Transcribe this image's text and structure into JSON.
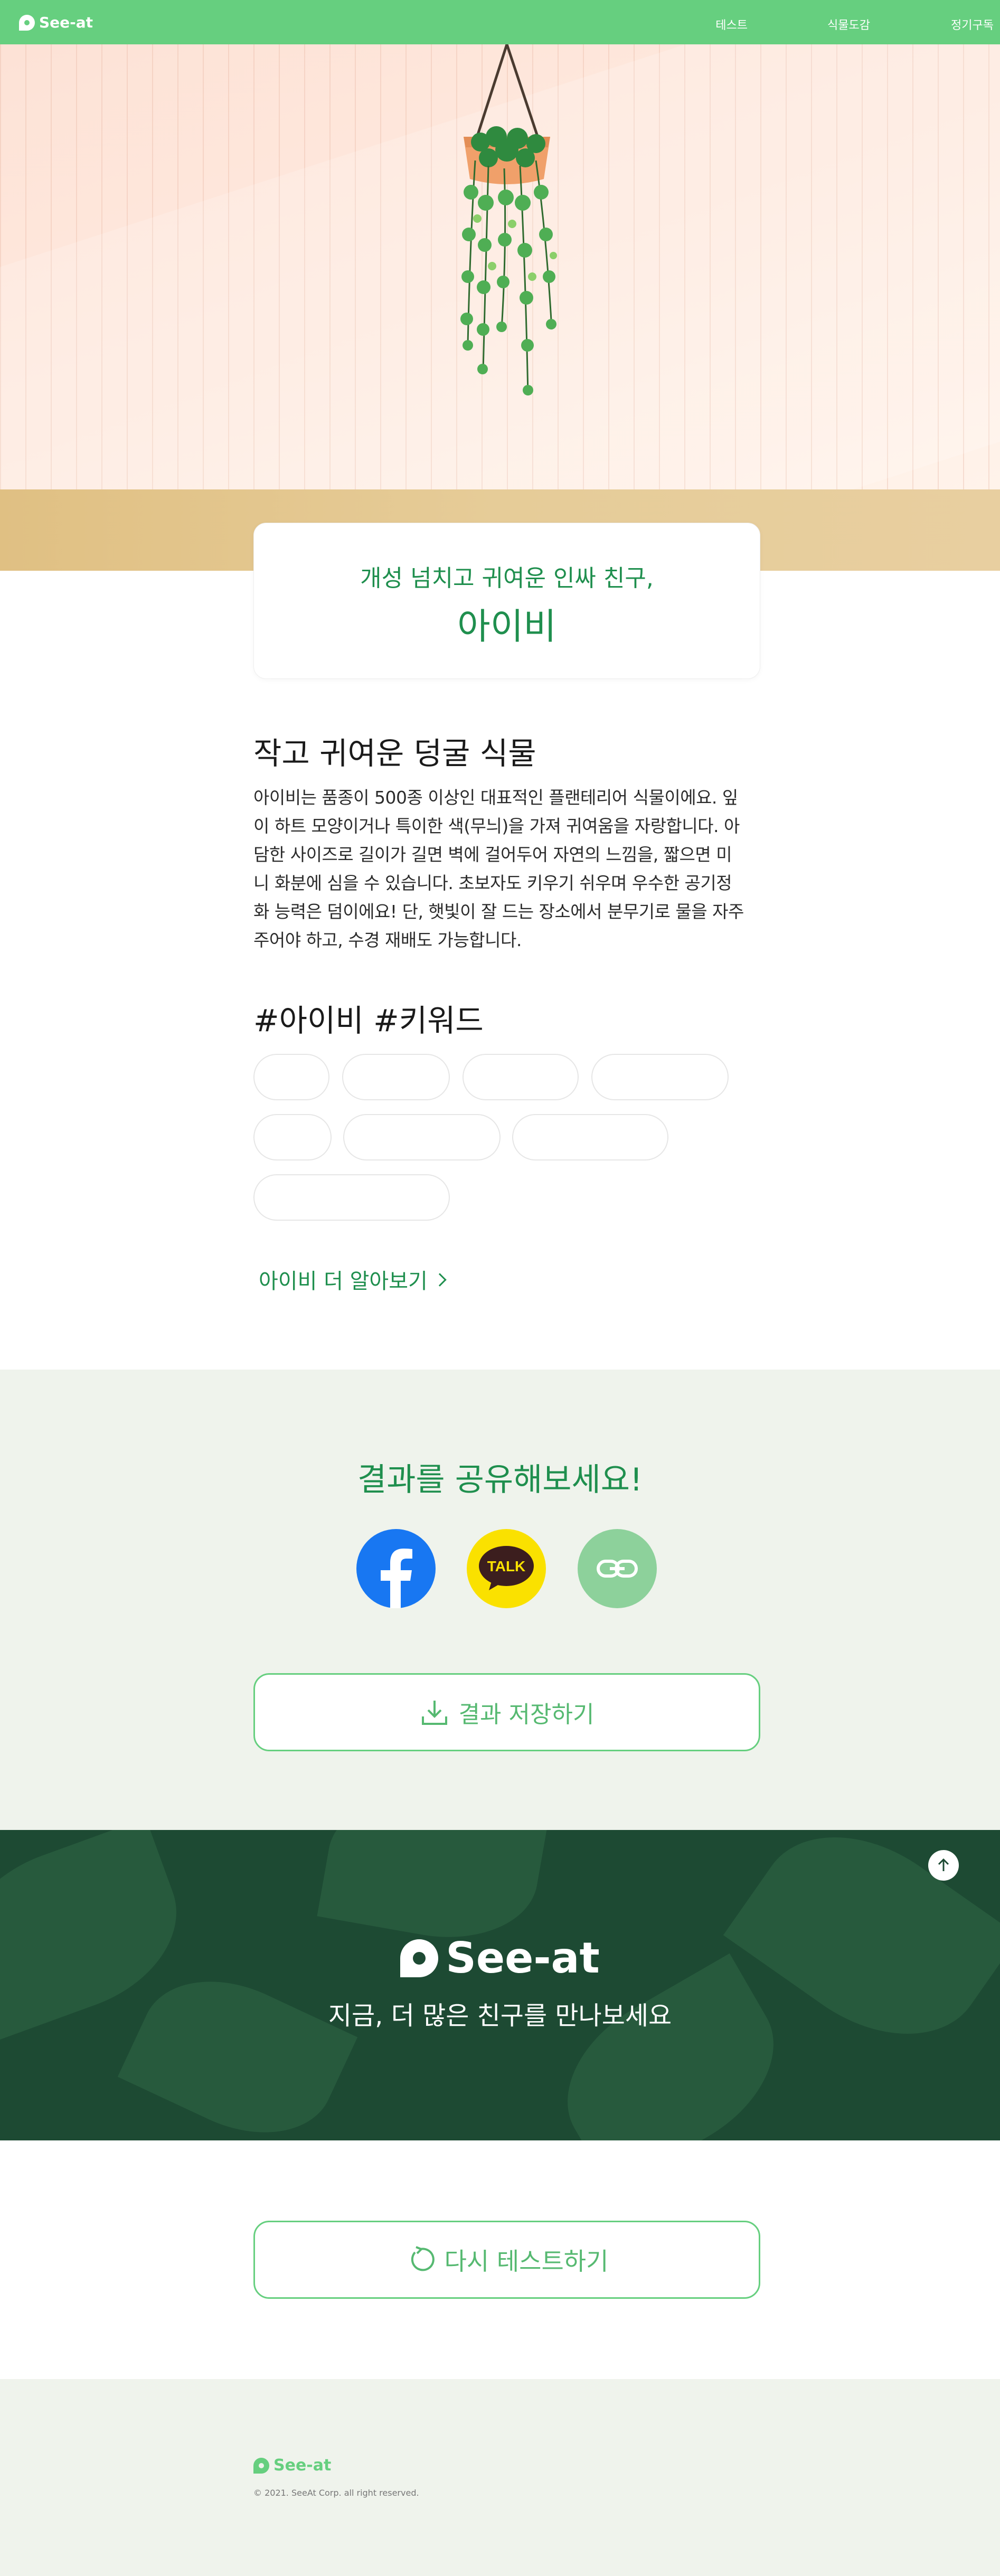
{
  "header": {
    "logo_text": "See-at",
    "nav": [
      "테스트",
      "식물도감",
      "정기구독"
    ],
    "bg_color": "#66cf7f"
  },
  "result_card": {
    "subtitle": "개성 넘치고 귀여운 인싸 친구,",
    "title": "아이비",
    "accent_color": "#1f8f4e"
  },
  "description": {
    "heading": "작고 귀여운 덩굴 식물",
    "lines": [
      "아이비는 품종이 500종 이상인 대표적인 플랜테리어 식물이에요. 잎",
      "이 하트 모양이거나 특이한 색(무늬)을 가져 귀여움을 자랑합니다. 아",
      "담한 사이즈로 길이가 길면 벽에 걸어두어 자연의 느낌을, 짧으면 미",
      "니 화분에 심을 수 있습니다. 초보자도 키우기 쉬우며 우수한 공기정",
      "화 능력은 덤이에요! 단, 햇빛이 잘 드는 장소에서 분무기로 물을 자주",
      "주어야 하고, 수경 재배도 가능합니다."
    ]
  },
  "keywords": {
    "heading": "#아이비 #키워드",
    "tags": [
      "",
      "",
      "",
      "",
      "",
      "",
      "",
      ""
    ]
  },
  "more_link": {
    "label": "아이비 더 알아보기"
  },
  "share": {
    "title": "결과를 공유해보세요!",
    "buttons": [
      {
        "icon": "facebook-icon",
        "color": "#1877f2"
      },
      {
        "icon": "kakaotalk-icon",
        "color": "#fae100",
        "text": "TALK"
      },
      {
        "icon": "link-icon",
        "color": "#8dd19b"
      }
    ],
    "save_label": "결과 저장하기"
  },
  "banner": {
    "logo_text": "See-at",
    "subtitle": "지금, 더 많은 친구를 만나보세요",
    "bg_color": "#1d4a33"
  },
  "retest": {
    "label": "다시 테스트하기"
  },
  "footer": {
    "logo_text": "See-at",
    "copyright": "© 2021. SeeAt Corp. all right reserved."
  }
}
